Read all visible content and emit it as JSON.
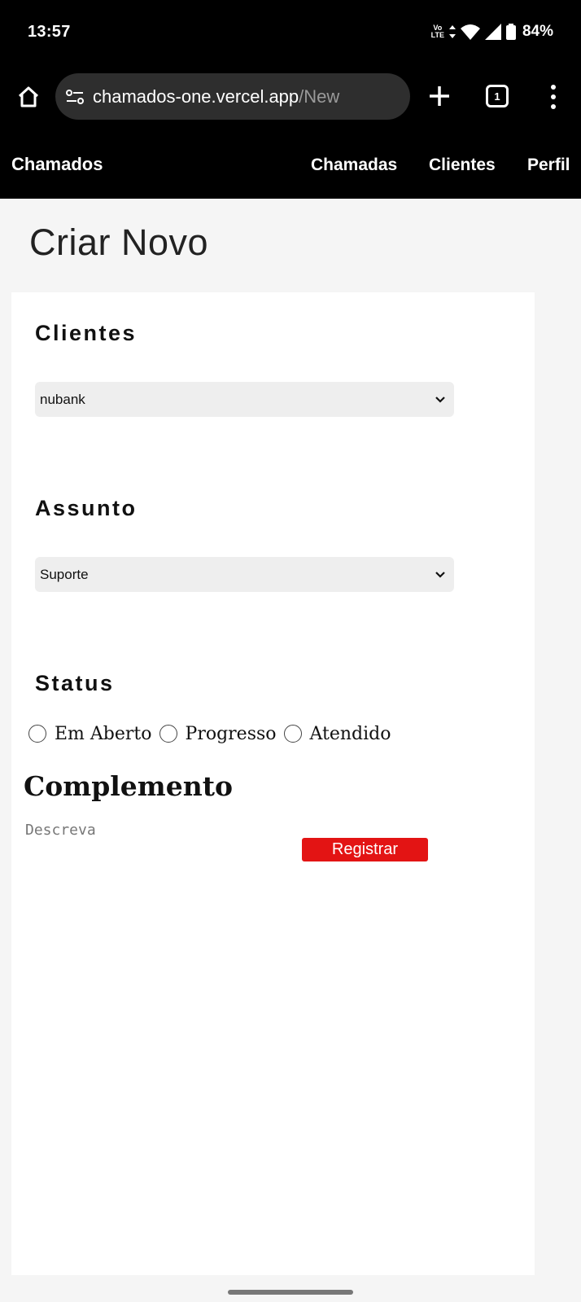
{
  "status_bar": {
    "time": "13:57",
    "network_label": "Vo LTE",
    "battery": "84%",
    "icons": [
      "volte-icon",
      "data-arrows-icon",
      "wifi-icon",
      "signal-icon",
      "battery-icon"
    ]
  },
  "browser": {
    "url_domain": "chamados-one.vercel.app",
    "url_path": "/New",
    "tab_count": "1",
    "icons": [
      "home-icon",
      "site-settings-icon",
      "plus-icon",
      "tabs-icon",
      "more-vert-icon"
    ]
  },
  "nav": {
    "brand": "Chamados",
    "links": [
      "Chamadas",
      "Clientes",
      "Perfil"
    ]
  },
  "page": {
    "title": "Criar Novo"
  },
  "form": {
    "clientes_label": "Clientes",
    "clientes_selected": "nubank",
    "assunto_label": "Assunto",
    "assunto_selected": "Suporte",
    "status_label": "Status",
    "status_options": [
      "Em Aberto",
      "Progresso",
      "Atendido"
    ],
    "complemento_label": "Complemento",
    "descricao_placeholder": "Descreva",
    "submit_label": "Registrar"
  },
  "colors": {
    "nav_background": "#000000",
    "submit_button": "#e31414",
    "select_background": "#eeeeee"
  }
}
